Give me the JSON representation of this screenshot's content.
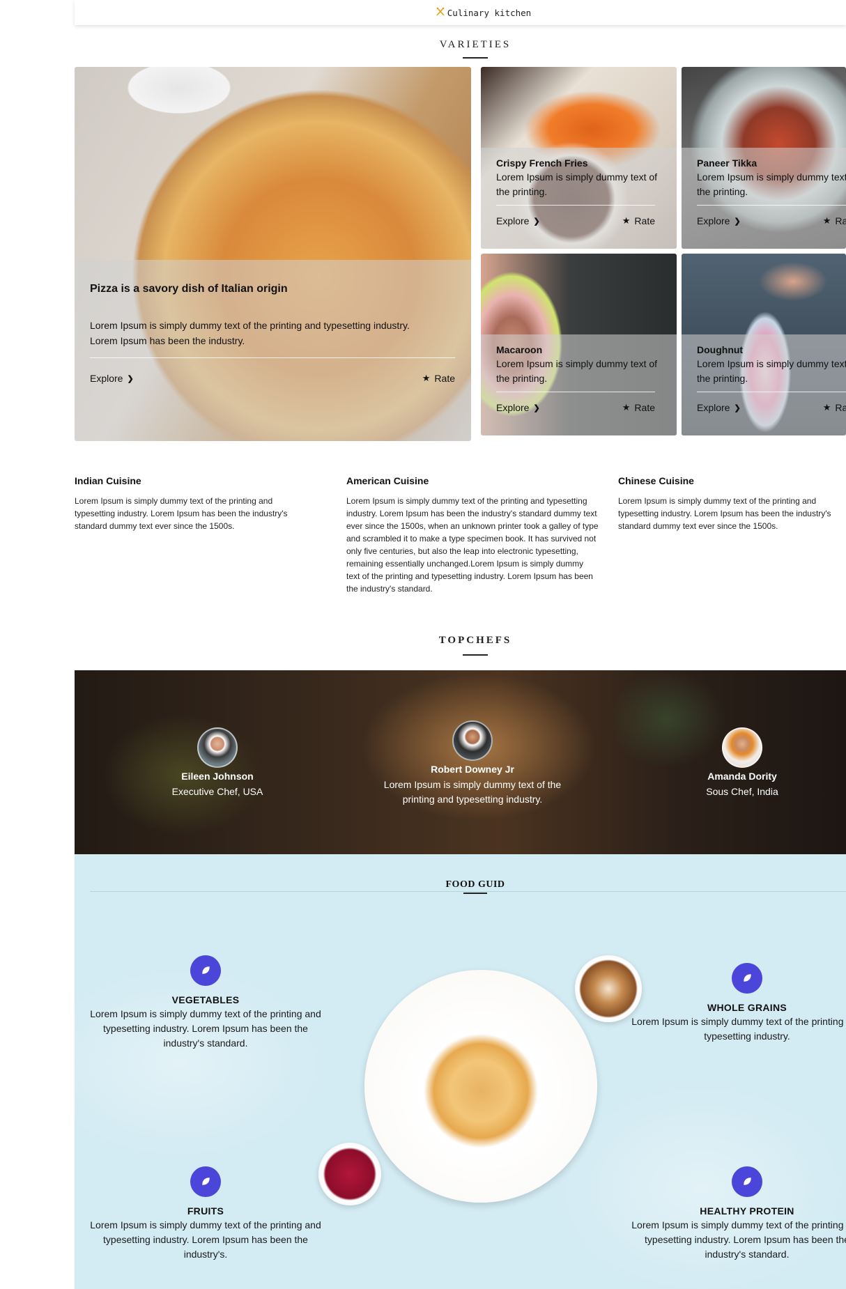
{
  "header": {
    "brand": "Culinary kitchen"
  },
  "varieties": {
    "title": "VARIETIES",
    "featured": {
      "title": "Pizza is a savory dish of Italian origin",
      "text": "Lorem Ipsum is simply dummy text of the printing and typesetting industry. Lorem Ipsum has been the industry.",
      "explore": "Explore",
      "rate": "Rate"
    },
    "cards": [
      {
        "title": "Crispy French Fries",
        "text": "Lorem Ipsum is simply dummy text of the printing.",
        "explore": "Explore",
        "rate": "Rate"
      },
      {
        "title": "Paneer Tikka",
        "text": "Lorem Ipsum is simply dummy text of the printing.",
        "explore": "Explore",
        "rate": "Rate"
      },
      {
        "title": "Macaroon",
        "text": "Lorem Ipsum is simply dummy text of the printing.",
        "explore": "Explore",
        "rate": "Rate"
      },
      {
        "title": "Doughnut",
        "text": "Lorem Ipsum is simply dummy text of the printing.",
        "explore": "Explore",
        "rate": "Rate"
      }
    ]
  },
  "cuisines": [
    {
      "title": "Indian Cuisine",
      "text": "Lorem Ipsum is simply dummy text of the printing and typesetting industry. Lorem Ipsum has been the industry's standard dummy text ever since the 1500s."
    },
    {
      "title": "American Cuisine",
      "text": "Lorem Ipsum is simply dummy text of the printing and typesetting industry. Lorem Ipsum has been the industry's standard dummy text ever since the 1500s, when an unknown printer took a galley of type and scrambled it to make a type specimen book. It has survived not only five centuries, but also the leap into electronic typesetting, remaining essentially unchanged.Lorem Ipsum is simply dummy text of the printing and typesetting industry. Lorem Ipsum has been the industry's standard."
    },
    {
      "title": "Chinese Cuisine",
      "text": "Lorem Ipsum is simply dummy text of the printing and typesetting industry. Lorem Ipsum has been the industry's standard dummy text ever since the 1500s."
    }
  ],
  "chefs": {
    "title": "TOPCHEFS",
    "items": [
      {
        "name": "Eileen Johnson",
        "subtitle": "Executive Chef, USA"
      },
      {
        "name": "Robert Downey Jr",
        "subtitle": "Lorem Ipsum is simply dummy text of the printing and typesetting industry."
      },
      {
        "name": "Amanda Dority",
        "subtitle": "Sous Chef, India"
      }
    ]
  },
  "guide": {
    "title": "FOOD GUID",
    "features": [
      {
        "title": "VEGETABLES",
        "text": "Lorem Ipsum is simply dummy text of the printing and typesetting industry. Lorem Ipsum has been the industry's standard."
      },
      {
        "title": "WHOLE GRAINS",
        "text": "Lorem Ipsum is simply dummy text of the printing and typesetting industry."
      },
      {
        "title": "FRUITS",
        "text": "Lorem Ipsum is simply dummy text of the printing and typesetting industry. Lorem Ipsum has been the industry's."
      },
      {
        "title": "HEALTHY PROTEIN",
        "text": "Lorem Ipsum is simply dummy text of the printing and typesetting industry. Lorem Ipsum has been the industry's standard."
      }
    ]
  },
  "colors": {
    "accent": "#4c45d9",
    "brand_icon": "#e0a21b"
  },
  "icons": {
    "brand": "utensils-icon",
    "explore": "chevron-right-icon",
    "rate": "star-icon",
    "feature": "leaf-icon"
  }
}
